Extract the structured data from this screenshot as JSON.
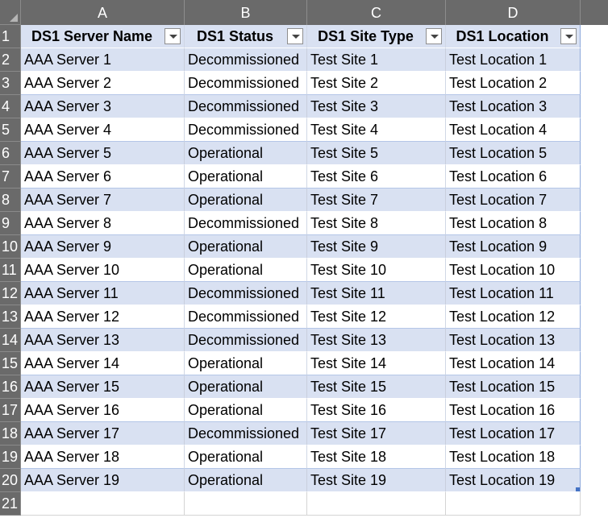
{
  "columns": [
    "A",
    "B",
    "C",
    "D"
  ],
  "headers": [
    "DS1 Server Name",
    "DS1 Status",
    "DS1 Site Type",
    "DS1 Location"
  ],
  "row_numbers": [
    "1",
    "2",
    "3",
    "4",
    "5",
    "6",
    "7",
    "8",
    "9",
    "10",
    "11",
    "12",
    "13",
    "14",
    "15",
    "16",
    "17",
    "18",
    "19",
    "20",
    "21"
  ],
  "rows": [
    [
      "AAA Server 1",
      "Decommissioned",
      "Test Site 1",
      "Test Location 1"
    ],
    [
      "AAA Server 2",
      "Decommissioned",
      "Test Site 2",
      "Test Location 2"
    ],
    [
      "AAA Server 3",
      "Decommissioned",
      "Test Site 3",
      "Test Location 3"
    ],
    [
      "AAA Server 4",
      "Decommissioned",
      "Test Site 4",
      "Test Location 4"
    ],
    [
      "AAA Server 5",
      "Operational",
      "Test Site 5",
      "Test Location 5"
    ],
    [
      "AAA Server 6",
      "Operational",
      "Test Site 6",
      "Test Location 6"
    ],
    [
      "AAA Server 7",
      "Operational",
      "Test Site 7",
      "Test Location 7"
    ],
    [
      "AAA Server 8",
      "Decommissioned",
      "Test Site 8",
      "Test Location 8"
    ],
    [
      "AAA Server 9",
      "Operational",
      "Test Site 9",
      "Test Location 9"
    ],
    [
      "AAA Server 10",
      "Operational",
      "Test Site 10",
      "Test Location 10"
    ],
    [
      "AAA Server 11",
      "Decommissioned",
      "Test Site 11",
      "Test Location 11"
    ],
    [
      "AAA Server 12",
      "Decommissioned",
      "Test Site 12",
      "Test Location 12"
    ],
    [
      "AAA Server 13",
      "Decommissioned",
      "Test Site 13",
      "Test Location 13"
    ],
    [
      "AAA Server 14",
      "Operational",
      "Test Site 14",
      "Test Location 14"
    ],
    [
      "AAA Server 15",
      "Operational",
      "Test Site 15",
      "Test Location 15"
    ],
    [
      "AAA Server 16",
      "Operational",
      "Test Site 16",
      "Test Location 16"
    ],
    [
      "AAA Server 17",
      "Decommissioned",
      "Test Site 17",
      "Test Location 17"
    ],
    [
      "AAA Server 18",
      "Operational",
      "Test Site 18",
      "Test Location 18"
    ],
    [
      "AAA Server 19",
      "Operational",
      "Test Site 19",
      "Test Location 19"
    ]
  ],
  "colors": {
    "header_bg": "#6a6a6a",
    "band": "#d9e1f2",
    "table_border": "#8ea9db"
  },
  "icons": {
    "filter": "filter-dropdown-icon",
    "resize": "table-resize-handle-icon"
  }
}
